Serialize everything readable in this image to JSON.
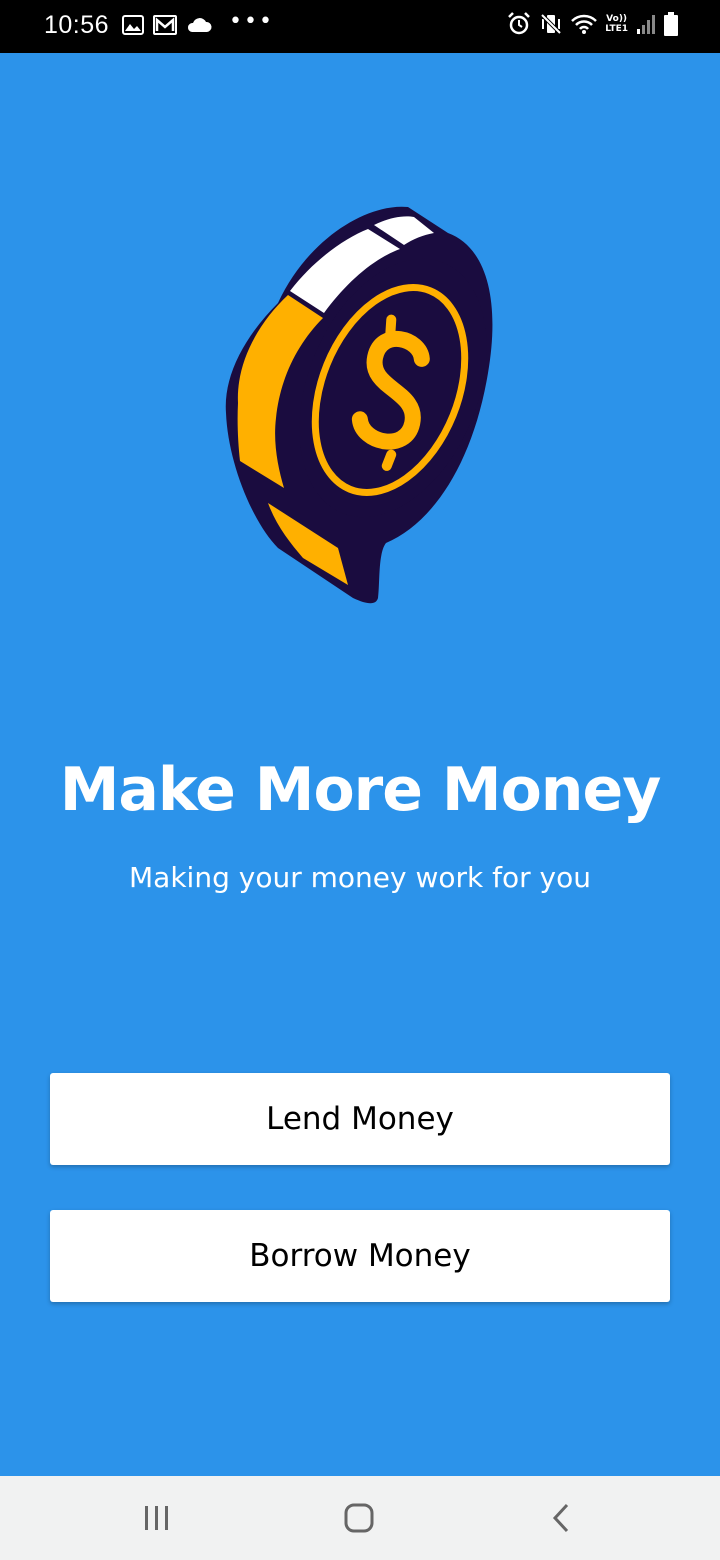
{
  "status_bar": {
    "time": "10:56",
    "left_icons": [
      "image-icon",
      "gmail-icon",
      "cloud-icon",
      "more-dots-icon"
    ],
    "more_dots": "•••",
    "right_icons": [
      "alarm-icon",
      "vibrate-mute-icon",
      "wifi-icon",
      "volte-icon",
      "signal-icon",
      "battery-icon"
    ],
    "volte_top": "Vo))",
    "volte_bottom": "LTE1"
  },
  "hero": {
    "illustration": "dollar-coin-icon",
    "colors": {
      "coin_dark": "#1a0c3f",
      "coin_gold": "#ffb000",
      "coin_highlight": "#ffffff"
    }
  },
  "headline": "Make More Money",
  "subline": "Making your money work for you",
  "actions": {
    "lend_label": "Lend Money",
    "borrow_label": "Borrow Money"
  },
  "nav_bar": {
    "icons": [
      "recent-apps-icon",
      "home-icon",
      "back-icon"
    ]
  },
  "theme": {
    "background": "#2c93ea",
    "button_bg": "#ffffff",
    "nav_bg": "#f1f2f2"
  }
}
